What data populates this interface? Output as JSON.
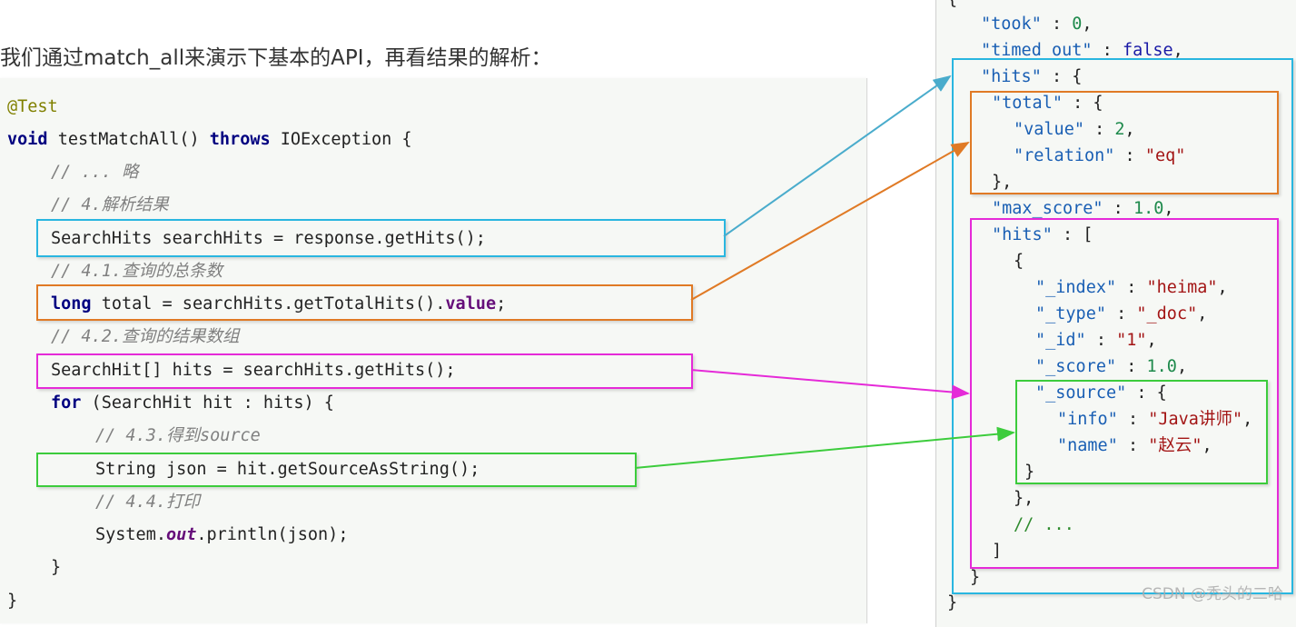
{
  "intro": "我们通过match_all来演示下基本的API，再看结果的解析：",
  "code": {
    "annotation": "@Test",
    "method_kw": "void",
    "method_sig": " testMatchAll() ",
    "throws_kw": "throws",
    "throws_rest": " IOException {",
    "comment_omit": "// ... 略",
    "comment_parse": "// 4.解析结果",
    "line_searchhits": "SearchHits searchHits = response.getHits();",
    "comment_total": "// 4.1.查询的总条数",
    "total_kw": "long",
    "total_mid": " total = searchHits.getTotalHits().",
    "total_field": "value",
    "total_end": ";",
    "comment_array": "// 4.2.查询的结果数组",
    "line_hits": "SearchHit[] hits = searchHits.getHits();",
    "for_kw": "for",
    "for_rest": " (SearchHit hit : hits) {",
    "comment_source": "// 4.3.得到source",
    "line_json": "String json = hit.getSourceAsString();",
    "comment_print": "// 4.4.打印",
    "print_a": "System.",
    "print_field": "out",
    "print_b": ".println(json);",
    "close_for": "}",
    "close_method": "}"
  },
  "json": {
    "open": "{",
    "took_key": "\"took\"",
    "took_val": "0",
    "timed_out_key": "\"timed_out\"",
    "timed_out_val": "false",
    "hits_key": "\"hits\"",
    "total_key": "\"total\"",
    "value_key": "\"value\"",
    "value_val": "2",
    "relation_key": "\"relation\"",
    "relation_val": "\"eq\"",
    "total_close": "},",
    "max_score_key": "\"max_score\"",
    "max_score_val": "1.0",
    "hits_arr_key": "\"hits\"",
    "obj_open": "{",
    "index_key": "\"_index\"",
    "index_val": "\"heima\"",
    "type_key": "\"_type\"",
    "type_val": "\"_doc\"",
    "id_key": "\"_id\"",
    "id_val": "\"1\"",
    "score_key": "\"_score\"",
    "score_val": "1.0",
    "source_key": "\"_source\"",
    "info_key": "\"info\"",
    "info_val": "\"Java讲师\"",
    "name_key": "\"name\"",
    "name_val": "\"赵云\"",
    "source_close": "}",
    "obj_close": "},",
    "ellipsis": "// ...",
    "arr_close": "]",
    "hits_close": "}",
    "close": "}"
  },
  "colors": {
    "blue": "#29b6e0",
    "orange": "#e07a25",
    "magenta": "#e52ad8",
    "green": "#3ccc3c"
  },
  "watermark": "CSDN @秃头的二哈"
}
